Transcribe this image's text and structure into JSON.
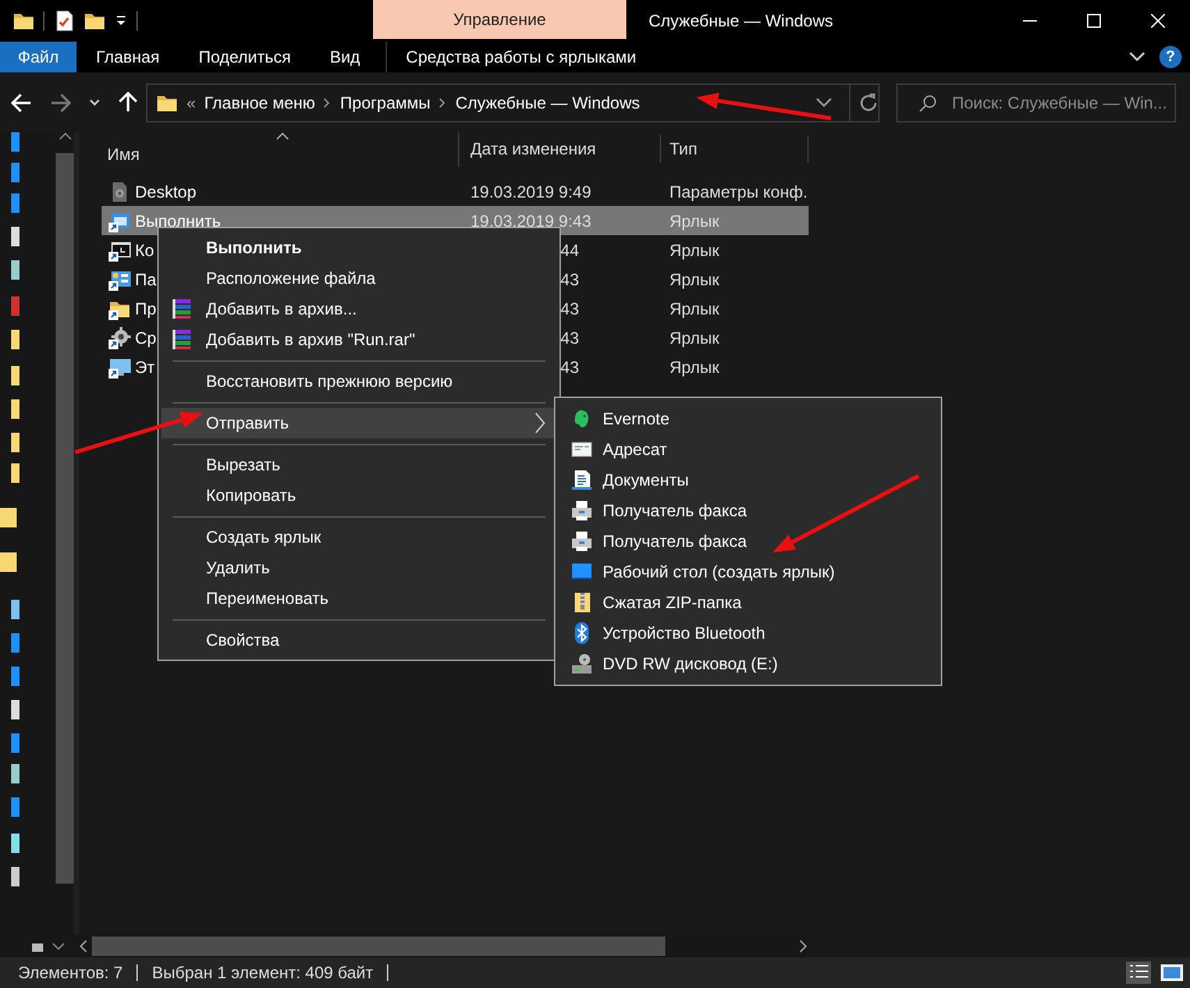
{
  "title_bar": {
    "context_tab": "Управление",
    "title": "Служебные — Windows"
  },
  "ribbon": {
    "tabs": [
      {
        "label": "Файл",
        "kind": "file"
      },
      {
        "label": "Главная",
        "kind": "tab"
      },
      {
        "label": "Поделиться",
        "kind": "tab"
      },
      {
        "label": "Вид",
        "kind": "tab"
      },
      {
        "label": "Средства работы с ярлыками",
        "kind": "context"
      }
    ],
    "help": "?"
  },
  "address_bar": {
    "overflow": "«",
    "path": [
      "Главное меню",
      "Программы",
      "Служебные — Windows"
    ]
  },
  "search": {
    "placeholder": "Поиск: Служебные — Win..."
  },
  "file_list": {
    "columns": [
      "Имя",
      "Дата изменения",
      "Тип"
    ],
    "rows": [
      {
        "name": "Desktop",
        "date": "19.03.2019 9:49",
        "type": "Параметры конф.",
        "kind": "config",
        "selected": false
      },
      {
        "name": "Выполнить",
        "date": "19.03.2019 9:43",
        "type": "Ярлык",
        "kind": "run",
        "selected": true
      },
      {
        "name": "Ко",
        "date": "44",
        "type": "Ярлык",
        "kind": "console",
        "selected": false
      },
      {
        "name": "Па",
        "date": "43",
        "type": "Ярлык",
        "kind": "panel",
        "selected": false
      },
      {
        "name": "Пр",
        "date": "43",
        "type": "Ярлык",
        "kind": "folder",
        "selected": false
      },
      {
        "name": "Ср",
        "date": "43",
        "type": "Ярлык",
        "kind": "tools",
        "selected": false
      },
      {
        "name": "Эт",
        "date": "43",
        "type": "Ярлык",
        "kind": "pc",
        "selected": false
      }
    ]
  },
  "context_menu": {
    "items": [
      {
        "kind": "command",
        "label": "Выполнить",
        "default": true,
        "selected": false
      },
      {
        "kind": "command",
        "label": "Расположение файла",
        "default": false,
        "selected": false
      },
      {
        "kind": "archive",
        "label": "Добавить в архив...",
        "default": false,
        "selected": false
      },
      {
        "kind": "archive",
        "label": "Добавить в архив \"Run.rar\"",
        "default": false,
        "selected": false
      },
      {
        "kind": "separator"
      },
      {
        "kind": "command",
        "label": "Восстановить прежнюю версию",
        "default": false,
        "selected": false
      },
      {
        "kind": "separator"
      },
      {
        "kind": "submenu",
        "label": "Отправить",
        "default": false,
        "selected": true
      },
      {
        "kind": "separator"
      },
      {
        "kind": "command",
        "label": "Вырезать",
        "default": false,
        "selected": false
      },
      {
        "kind": "command",
        "label": "Копировать",
        "default": false,
        "selected": false
      },
      {
        "kind": "separator"
      },
      {
        "kind": "command",
        "label": "Создать ярлык",
        "default": false,
        "selected": false
      },
      {
        "kind": "command",
        "label": "Удалить",
        "default": false,
        "selected": false
      },
      {
        "kind": "command",
        "label": "Переименовать",
        "default": false,
        "selected": false
      },
      {
        "kind": "separator"
      },
      {
        "kind": "command",
        "label": "Свойства",
        "default": false,
        "selected": false
      }
    ]
  },
  "send_to_menu": {
    "items": [
      {
        "label": "Evernote",
        "kind": "evernote"
      },
      {
        "label": "Адресат",
        "kind": "mail"
      },
      {
        "label": "Документы",
        "kind": "documents"
      },
      {
        "label": "Получатель факса",
        "kind": "fax"
      },
      {
        "label": "Получатель факса",
        "kind": "fax"
      },
      {
        "label": "Рабочий стол (создать ярлык)",
        "kind": "desktop"
      },
      {
        "label": "Сжатая ZIP-папка",
        "kind": "zip"
      },
      {
        "label": "Устройство Bluetooth",
        "kind": "bluetooth"
      },
      {
        "label": "DVD RW дисковод (E:)",
        "kind": "dvd"
      }
    ]
  },
  "status_bar": {
    "item_count": "Элементов: 7",
    "selection": "Выбран 1 элемент: 409 байт"
  }
}
